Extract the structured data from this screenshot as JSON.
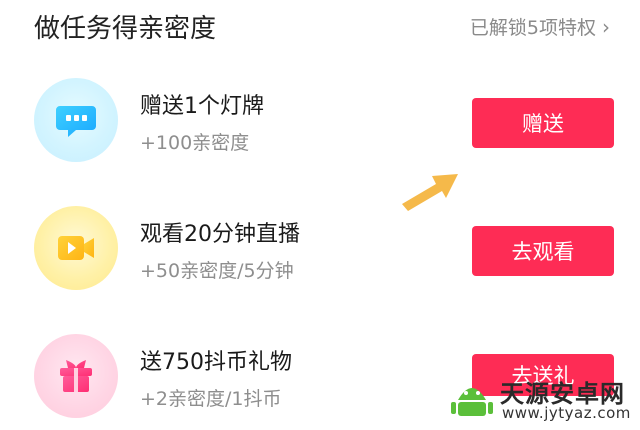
{
  "header": {
    "title": "做任务得亲密度",
    "unlock_text": "已解锁5项特权"
  },
  "tasks": [
    {
      "title": "赠送1个灯牌",
      "subtitle": "+100亲密度",
      "button": "赠送",
      "icon": "chat-bubble-icon"
    },
    {
      "title": "观看20分钟直播",
      "subtitle": "+50亲密度/5分钟",
      "button": "去观看",
      "icon": "video-camera-icon"
    },
    {
      "title": "送750抖币礼物",
      "subtitle": "+2亲密度/1抖币",
      "button": "去送礼",
      "icon": "gift-icon"
    }
  ],
  "watermark": {
    "name": "天源安卓网",
    "url": "www.jytyaz.com"
  },
  "colors": {
    "accent": "#fe2c55",
    "arrow": "#f5b94a",
    "muted_text": "#8e8e8e"
  }
}
